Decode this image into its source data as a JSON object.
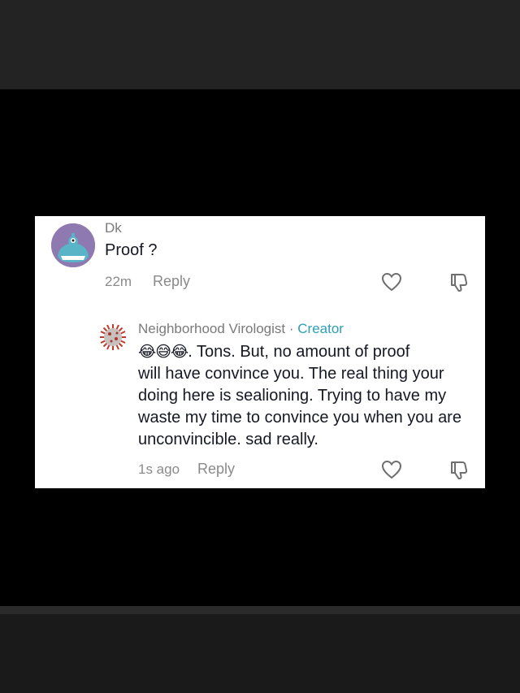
{
  "comments": [
    {
      "username": "Dk",
      "text": "Proof ?",
      "time": "22m",
      "reply_label": "Reply",
      "avatar_icon": "monster-avatar-icon"
    }
  ],
  "reply": {
    "username": "Neighborhood Virologist",
    "separator": " · ",
    "badge": "Creator",
    "emojis": "😂😅😂",
    "text_line1": ". Tons. But, no amount of proof",
    "text_rest": "will have convince you. The real thing your doing here is sealioning. Trying to have my waste my time to convince you when you are unconvincible. sad really.",
    "time": "1s ago",
    "reply_label": "Reply",
    "avatar_icon": "virus-avatar-icon"
  },
  "colors": {
    "card_bg": "#ffffff",
    "creator_badge": "#2e9fb2",
    "text": "#161823",
    "muted": "#8a8a8a"
  }
}
